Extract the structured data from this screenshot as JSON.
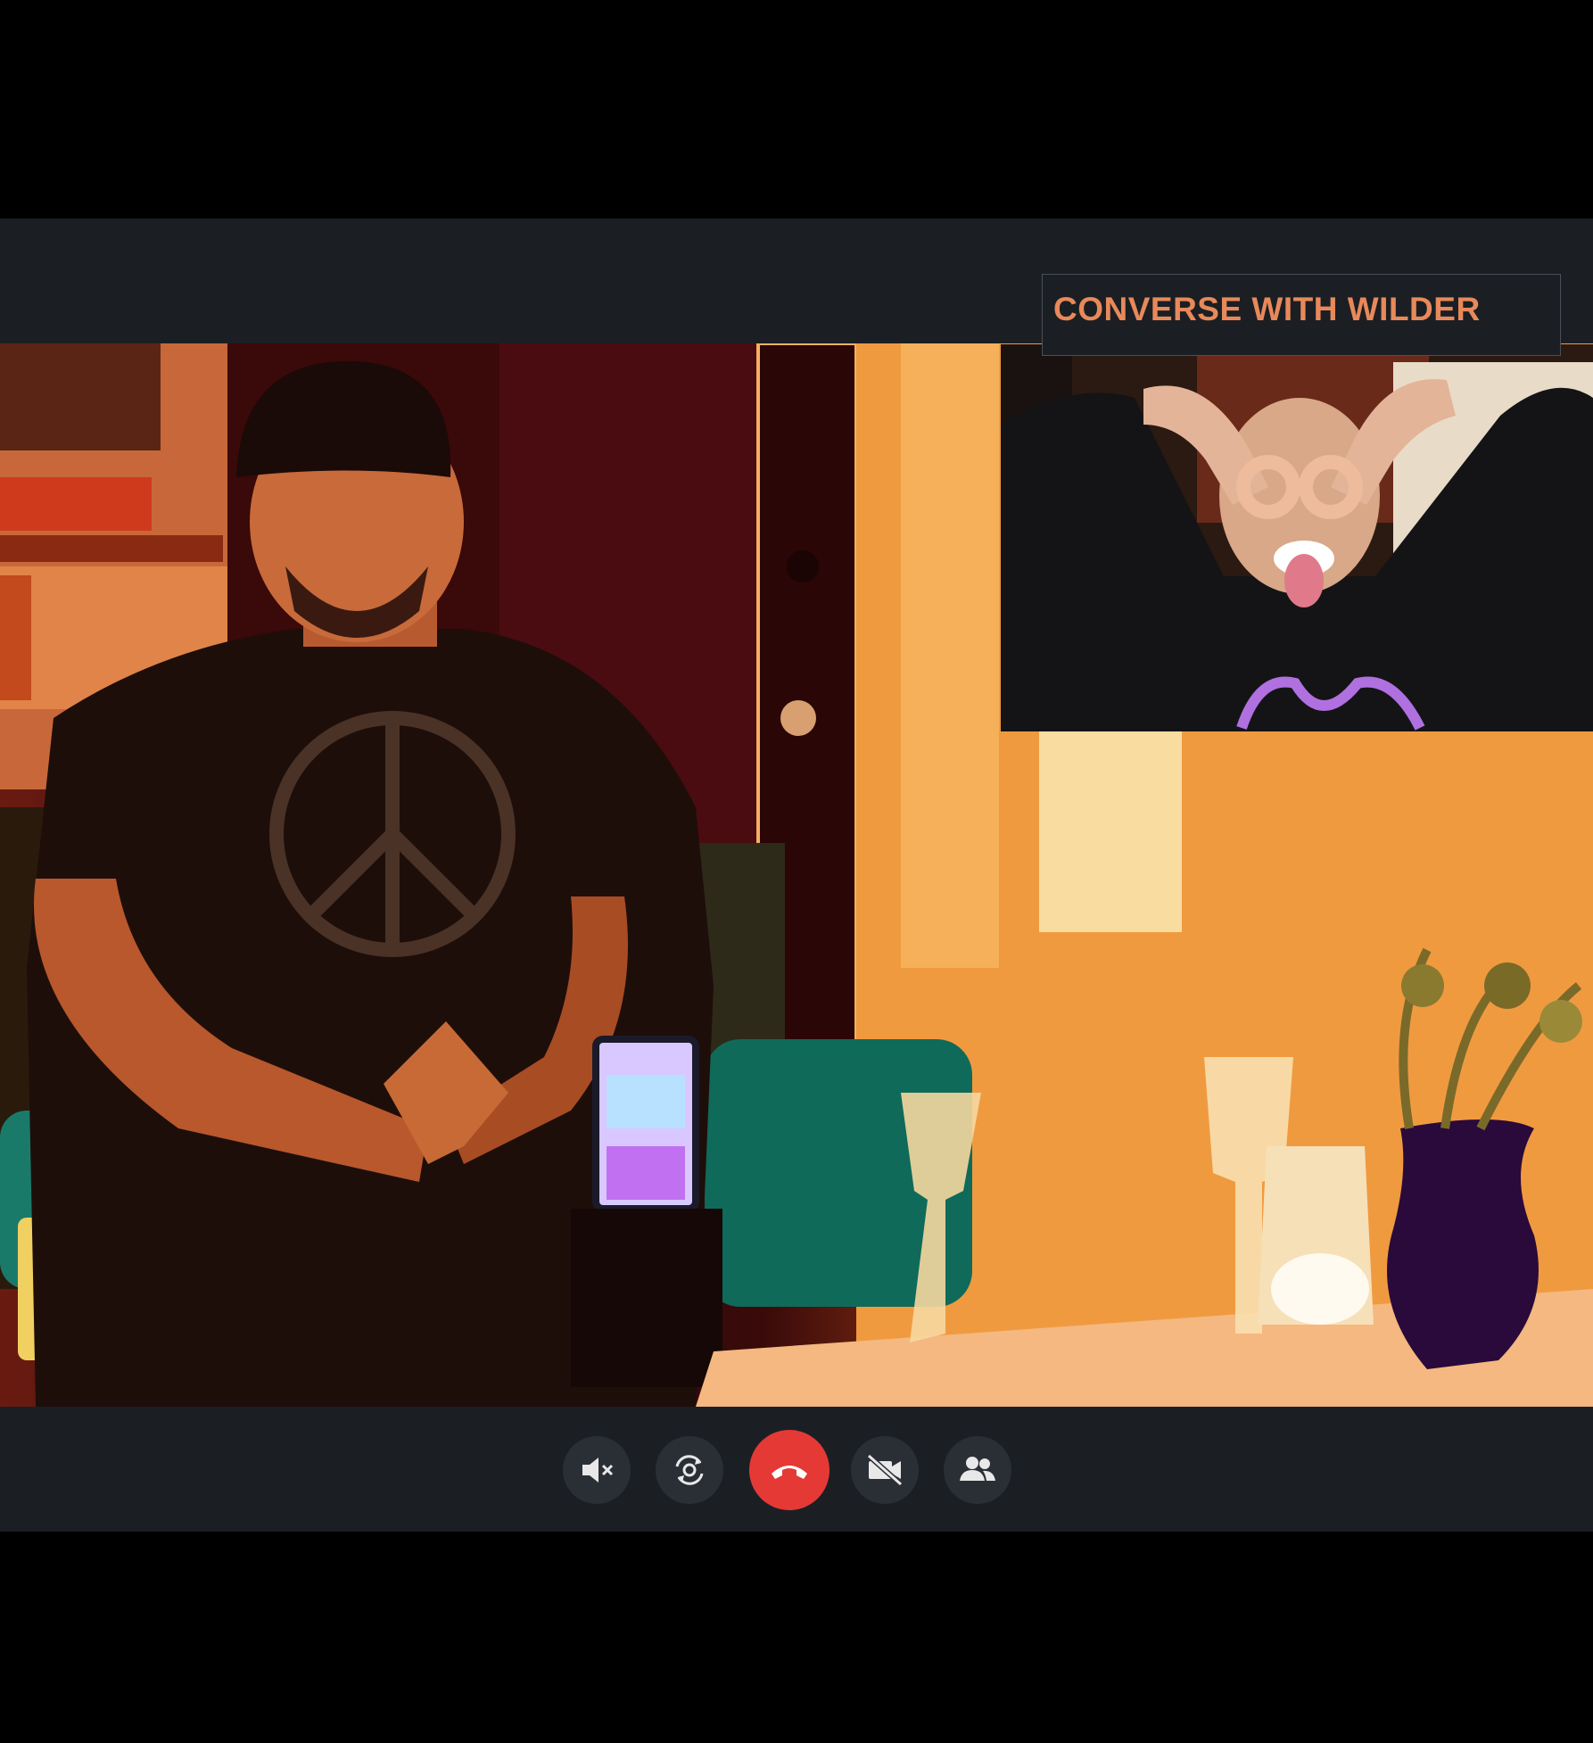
{
  "header": {
    "title": "CONVERSE WITH WILDER"
  },
  "controls": {
    "mute_icon": "speaker-muted-icon",
    "flip_icon": "camera-flip-icon",
    "end_icon": "phone-hangup-icon",
    "video_off_icon": "video-off-icon",
    "participants_icon": "participants-icon"
  },
  "colors": {
    "title": "#e8895a",
    "bar_background": "#1b1f24",
    "control_button": "#2a2f36",
    "end_call": "#e53935"
  }
}
